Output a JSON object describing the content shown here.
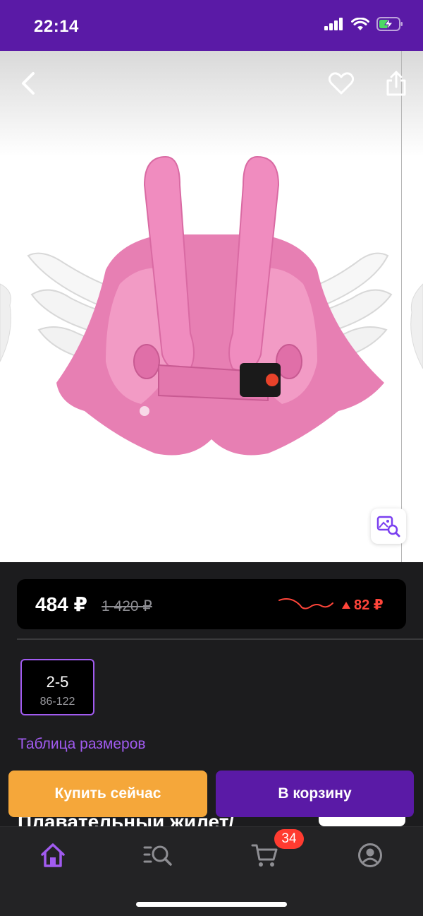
{
  "status_bar": {
    "time": "22:14",
    "icons": [
      "cellular-signal-icon",
      "wifi-icon",
      "battery-charging-icon"
    ]
  },
  "gallery": {
    "icons": [
      "back-icon",
      "heart-icon",
      "share-icon",
      "visual-search-icon"
    ]
  },
  "price": {
    "current": "484 ₽",
    "old": "1 420 ₽",
    "change": "82 ₽",
    "change_color": "#ff453a"
  },
  "size": {
    "label": "2-5",
    "range": "86-122"
  },
  "size_table_link": "Таблица размеров",
  "product_title": "Плавательный жилет/",
  "actions": {
    "buy_now": "Купить сейчас",
    "add_to_cart": "В корзину"
  },
  "tab_bar": {
    "cart_badge": "34",
    "tabs": [
      "home-icon",
      "catalog-search-icon",
      "cart-icon",
      "profile-icon"
    ]
  },
  "colors": {
    "brand_purple": "#5a1aa6",
    "accent_purple": "#a15bf0",
    "buy_orange": "#f5a73a",
    "badge_red": "#ff3b30"
  }
}
